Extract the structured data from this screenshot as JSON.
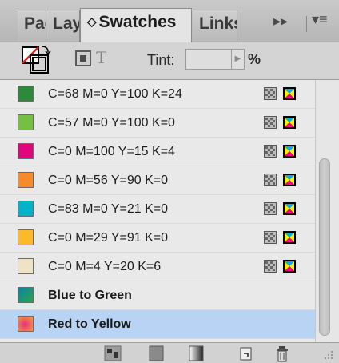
{
  "tabs": [
    {
      "label": "Pages"
    },
    {
      "label": "Layers"
    },
    {
      "label": "Swatches",
      "arrows": "◇"
    },
    {
      "label": "Links"
    }
  ],
  "tab_menu_glyph": "▸▸",
  "panel_menu_glyph": "▾≡",
  "toolbar": {
    "tint_label": "Tint:",
    "tint_value": "",
    "tint_unit": "%",
    "text_icon_glyph": "T",
    "stepper_glyph": "▶"
  },
  "swatches": [
    {
      "name": "C=68 M=0 Y=100 K=24",
      "color": "#2d8a3a",
      "kind": "process"
    },
    {
      "name": "C=57 M=0 Y=100 K=0",
      "color": "#75c043",
      "kind": "process"
    },
    {
      "name": "C=0 M=100 Y=15 K=4",
      "color": "#e2067c",
      "kind": "process"
    },
    {
      "name": "C=0 M=56 Y=90 K=0",
      "color": "#f58b2b",
      "kind": "process"
    },
    {
      "name": "C=83 M=0 Y=21 K=0",
      "color": "#00b3cb",
      "kind": "process"
    },
    {
      "name": "C=0 M=29 Y=91 K=0",
      "color": "#fdb92c",
      "kind": "process"
    },
    {
      "name": "C=0 M=4 Y=20 K=6",
      "color": "#efe3c6",
      "kind": "process"
    },
    {
      "name": "Blue to Green",
      "gradient": [
        "#0b84a5",
        "#2fa34b"
      ],
      "kind": "gradient"
    },
    {
      "name": "Red to Yellow",
      "gradient": [
        "#e8307b",
        "#f7a23a"
      ],
      "kind": "gradient",
      "selected": true
    }
  ],
  "colors": {
    "selection": "#b8d3f3",
    "panel_bg": "#e9e9e9"
  },
  "icons": {
    "fill_stroke": "fill-stroke-swap-icon",
    "container": "formatting-container-icon",
    "text": "formatting-text-icon",
    "cmyk": "cmyk-mode-icon",
    "process": "process-color-icon",
    "bottom": [
      "show-all-swatches-icon",
      "show-color-swatches-icon",
      "show-gradient-swatches-icon",
      "new-swatch-icon",
      "delete-swatch-icon"
    ]
  }
}
